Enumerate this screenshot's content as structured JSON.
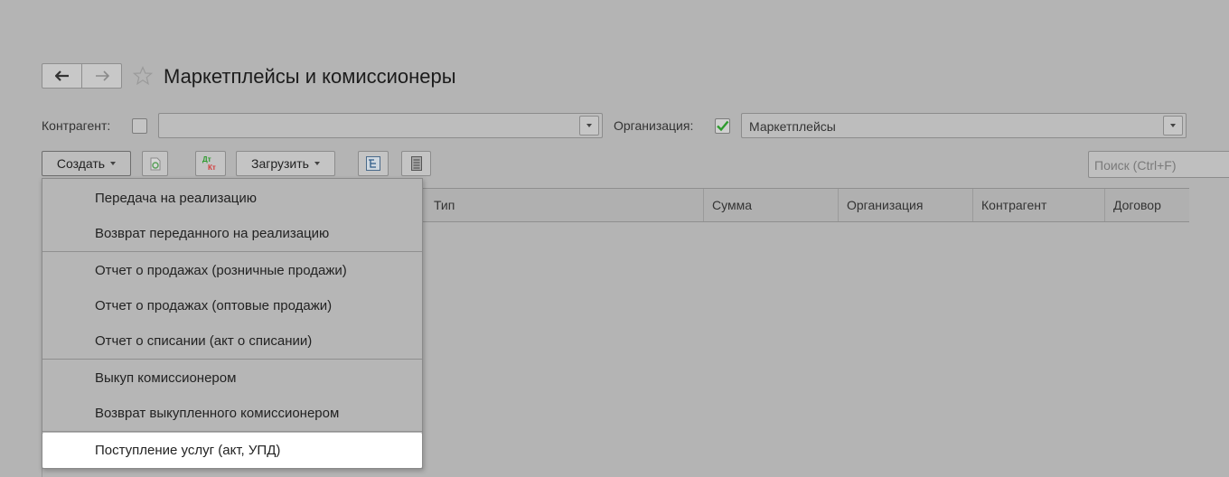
{
  "header": {
    "title": "Маркетплейсы и комиссионеры"
  },
  "filters": {
    "counterparty_label": "Контрагент:",
    "counterparty_value": "",
    "organization_label": "Организация:",
    "organization_value": "Маркетплейсы"
  },
  "toolbar": {
    "create_label": "Создать",
    "load_label": "Загрузить",
    "search_placeholder": "Поиск (Ctrl+F)"
  },
  "table": {
    "columns": [
      "Тип",
      "Сумма",
      "Организация",
      "Контрагент",
      "Договор"
    ]
  },
  "create_menu": {
    "items": [
      "Передача на реализацию",
      "Возврат переданного на реализацию",
      "Отчет о продажах (розничные продажи)",
      "Отчет о продажах (оптовые продажи)",
      "Отчет о списании (акт о списании)",
      "Выкуп комиссионером",
      "Возврат выкупленного комиссионером",
      "Поступление услуг (акт, УПД)"
    ],
    "highlighted_index": 7
  },
  "colors": {
    "checkbox_check": "#2e9b2e",
    "dtkt_green": "#2e9b2e",
    "dtkt_red": "#d23a3a"
  }
}
